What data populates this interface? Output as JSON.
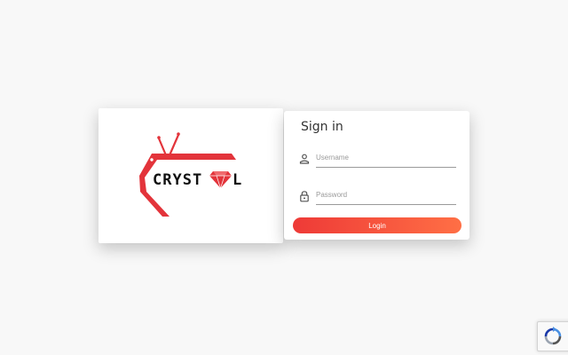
{
  "logo": {
    "brand_left": "CRYST",
    "brand_right": "L",
    "colors": {
      "red": "#e3343b",
      "black": "#111111"
    }
  },
  "login": {
    "title": "Sign in",
    "username_placeholder": "Username",
    "password_placeholder": "Password",
    "login_label": "Login",
    "button_gradient": [
      "#ee3a37",
      "#ff6f45"
    ]
  },
  "icons": {
    "username": "person-icon",
    "password": "lock-icon",
    "captcha": "recaptcha-icon"
  }
}
